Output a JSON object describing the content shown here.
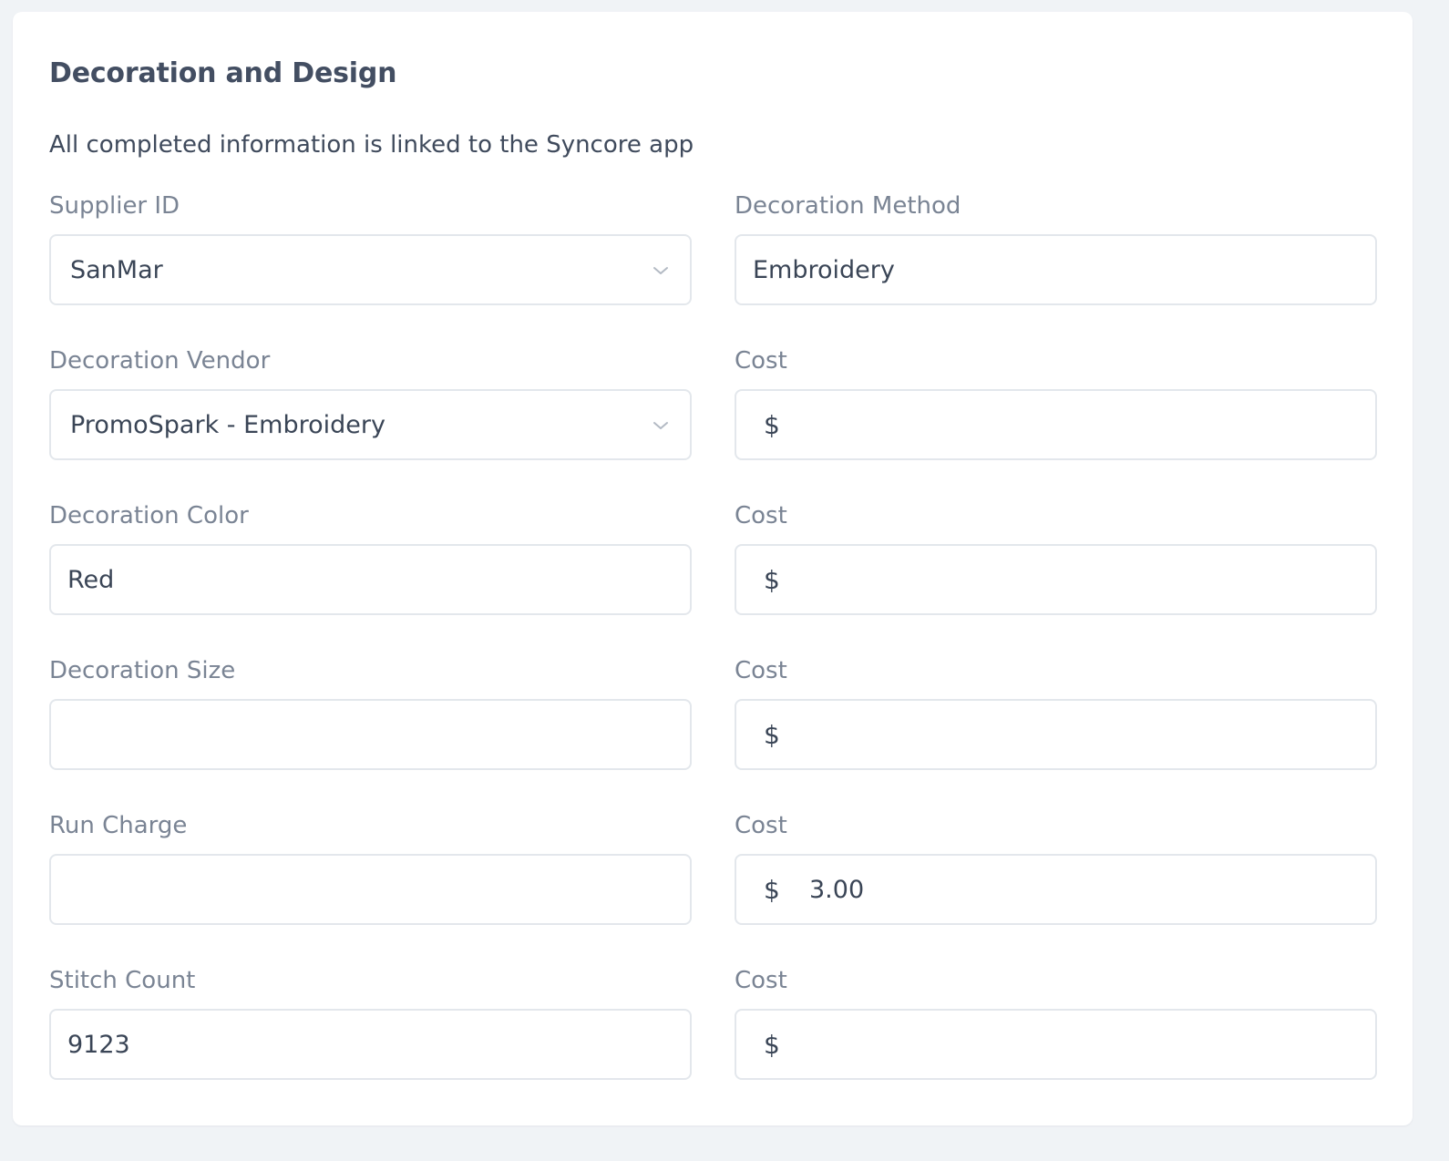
{
  "section": {
    "title": "Decoration and Design",
    "subtitle": "All completed information is linked to the Syncore app"
  },
  "fields": {
    "supplier_id": {
      "label": "Supplier ID",
      "value": "SanMar",
      "type": "select"
    },
    "decoration_method": {
      "label": "Decoration Method",
      "value": "Embroidery"
    },
    "decoration_vendor": {
      "label": "Decoration Vendor",
      "value": "PromoSpark - Embroidery",
      "type": "select"
    },
    "decoration_vendor_cost": {
      "label": "Cost",
      "currency": "$",
      "value": ""
    },
    "decoration_color": {
      "label": "Decoration Color",
      "value": "Red"
    },
    "decoration_color_cost": {
      "label": "Cost",
      "currency": "$",
      "value": ""
    },
    "decoration_size": {
      "label": "Decoration Size",
      "value": ""
    },
    "decoration_size_cost": {
      "label": "Cost",
      "currency": "$",
      "value": ""
    },
    "run_charge": {
      "label": "Run Charge",
      "value": ""
    },
    "run_charge_cost": {
      "label": "Cost",
      "currency": "$",
      "value": "3.00"
    },
    "stitch_count": {
      "label": "Stitch Count",
      "value": "9123"
    },
    "stitch_count_cost": {
      "label": "Cost",
      "currency": "$",
      "value": ""
    }
  },
  "icons": {
    "select_chevron": "chevron-down-icon"
  },
  "colors": {
    "page_background": "#f0f3f6",
    "card_background": "#ffffff",
    "label_text": "#7a8494",
    "value_text": "#3a4556",
    "border": "#e3e7ec"
  }
}
